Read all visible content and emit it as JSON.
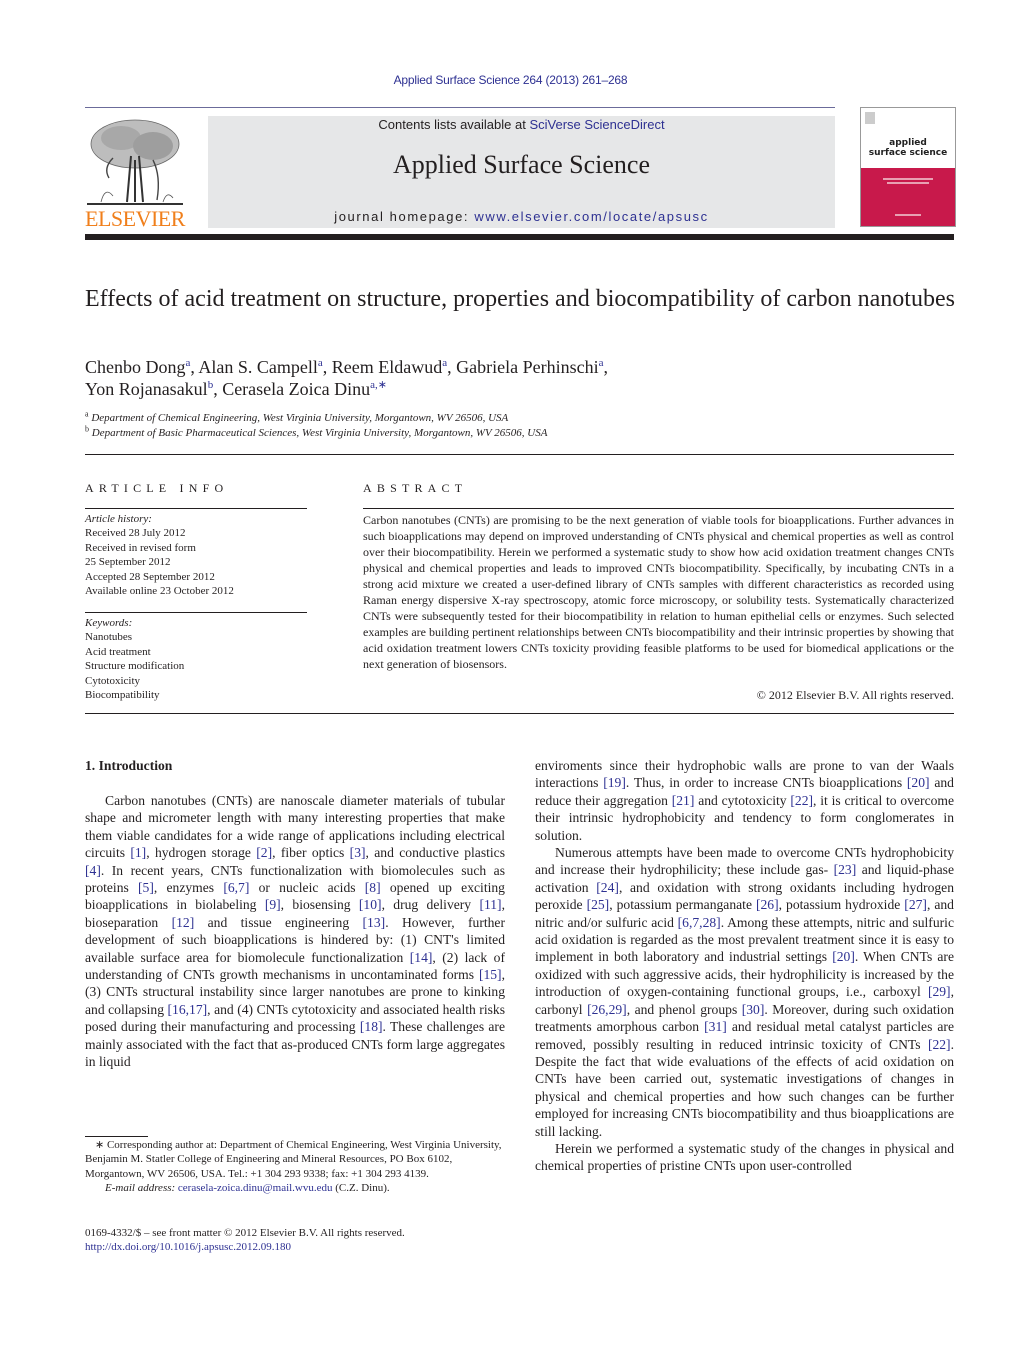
{
  "header": {
    "citation": "Applied Surface Science 264 (2013) 261–268",
    "contents_prefix": "Contents lists available at ",
    "contents_link": "SciVerse ScienceDirect",
    "journal_title": "Applied Surface Science",
    "homepage_prefix": "journal homepage: ",
    "homepage_link": "www.elsevier.com/locate/apsusc",
    "publisher_logo_text": "ELSEVIER",
    "cover_title_line1": "applied",
    "cover_title_line2": "surface science"
  },
  "article": {
    "title": "Effects of acid treatment on structure, properties and biocompatibility of carbon nanotubes",
    "authors": [
      {
        "name": "Chenbo Dong",
        "aff": "a",
        "sep": ", "
      },
      {
        "name": "Alan S. Campell",
        "aff": "a",
        "sep": ", "
      },
      {
        "name": "Reem Eldawud",
        "aff": "a",
        "sep": ", "
      },
      {
        "name": "Gabriela Perhinschi",
        "aff": "a",
        "sep": ","
      },
      {
        "name": "Yon Rojanasakul",
        "aff": "b",
        "sep": ", "
      },
      {
        "name": "Cerasela Zoica Dinu",
        "aff": "a,∗",
        "sep": ""
      }
    ],
    "affiliations": [
      {
        "mark": "a",
        "text": "Department of Chemical Engineering, West Virginia University, Morgantown, WV 26506, USA"
      },
      {
        "mark": "b",
        "text": "Department of Basic Pharmaceutical Sciences, West Virginia University, Morgantown, WV 26506, USA"
      }
    ]
  },
  "article_info": {
    "heading": "ARTICLE INFO",
    "history_label": "Article history:",
    "history": [
      "Received 28 July 2012",
      "Received in revised form",
      "25 September 2012",
      "Accepted 28 September 2012",
      "Available online 23 October 2012"
    ],
    "keywords_label": "Keywords:",
    "keywords": [
      "Nanotubes",
      "Acid treatment",
      "Structure modification",
      "Cytotoxicity",
      "Biocompatibility"
    ]
  },
  "abstract": {
    "heading": "ABSTRACT",
    "text": "Carbon nanotubes (CNTs) are promising to be the next generation of viable tools for bioapplications. Further advances in such bioapplications may depend on improved understanding of CNTs physical and chemical properties as well as control over their biocompatibility. Herein we performed a systematic study to show how acid oxidation treatment changes CNTs physical and chemical properties and leads to improved CNTs biocompatibility. Specifically, by incubating CNTs in a strong acid mixture we created a user-defined library of CNTs samples with different characteristics as recorded using Raman energy dispersive X-ray spectroscopy, atomic force microscopy, or solubility tests. Systematically characterized CNTs were subsequently tested for their biocompatibility in relation to human epithelial cells or enzymes. Such selected examples are building pertinent relationships between CNTs biocompatibility and their intrinsic properties by showing that acid oxidation treatment lowers CNTs toxicity providing feasible platforms to be used for biomedical applications or the next generation of biosensors.",
    "copyright": "© 2012 Elsevier B.V. All rights reserved."
  },
  "body": {
    "intro_heading": "1.  Introduction",
    "left_paragraphs": [
      [
        {
          "t": "Carbon nanotubes (CNTs) are nanoscale diameter materials of tubular shape and micrometer length with many interesting properties that make them viable candidates for a wide range of applications including electrical circuits "
        },
        {
          "r": "[1]"
        },
        {
          "t": ", hydrogen storage "
        },
        {
          "r": "[2]"
        },
        {
          "t": ", fiber optics "
        },
        {
          "r": "[3]"
        },
        {
          "t": ", and conductive plastics "
        },
        {
          "r": "[4]"
        },
        {
          "t": ". In recent years, CNTs functionalization with biomolecules such as proteins "
        },
        {
          "r": "[5]"
        },
        {
          "t": ", enzymes "
        },
        {
          "r": "[6,7]"
        },
        {
          "t": " or nucleic acids "
        },
        {
          "r": "[8]"
        },
        {
          "t": " opened up exciting bioapplications in biolabeling "
        },
        {
          "r": "[9]"
        },
        {
          "t": ", biosensing "
        },
        {
          "r": "[10]"
        },
        {
          "t": ", drug delivery "
        },
        {
          "r": "[11]"
        },
        {
          "t": ", bioseparation "
        },
        {
          "r": "[12]"
        },
        {
          "t": " and tissue engineering "
        },
        {
          "r": "[13]"
        },
        {
          "t": ". However, further development of such bioapplications is hindered by: (1) CNT's limited available surface area for biomolecule functionalization "
        },
        {
          "r": "[14]"
        },
        {
          "t": ", (2) lack of understanding of CNTs growth mechanisms in uncontaminated forms "
        },
        {
          "r": "[15]"
        },
        {
          "t": ", (3) CNTs structural instability since larger nanotubes are prone to kinking and collapsing "
        },
        {
          "r": "[16,17]"
        },
        {
          "t": ", and (4) CNTs cytotoxicity and associated health risks posed during their manufacturing and processing "
        },
        {
          "r": "[18]"
        },
        {
          "t": ". These challenges are mainly associated with the fact that as-produced CNTs form large aggregates in liquid"
        }
      ]
    ],
    "right_paragraphs": [
      {
        "indent": false,
        "runs": [
          {
            "t": "enviroments since their hydrophobic walls are prone to van der Waals interactions "
          },
          {
            "r": "[19]"
          },
          {
            "t": ". Thus, in order to increase CNTs bioapplications "
          },
          {
            "r": "[20]"
          },
          {
            "t": " and reduce their aggregation "
          },
          {
            "r": "[21]"
          },
          {
            "t": " and cytotoxicity "
          },
          {
            "r": "[22]"
          },
          {
            "t": ", it is critical to overcome their intrinsic hydrophobicity and tendency to form conglomerates in solution."
          }
        ]
      },
      {
        "indent": true,
        "runs": [
          {
            "t": "Numerous attempts have been made to overcome CNTs hydrophobicity and increase their hydrophilicity; these include gas- "
          },
          {
            "r": "[23]"
          },
          {
            "t": " and liquid-phase activation "
          },
          {
            "r": "[24]"
          },
          {
            "t": ", and oxidation with strong oxidants including hydrogen peroxide "
          },
          {
            "r": "[25]"
          },
          {
            "t": ", potassium permanganate "
          },
          {
            "r": "[26]"
          },
          {
            "t": ", potassium hydroxide "
          },
          {
            "r": "[27]"
          },
          {
            "t": ", and nitric and/or sulfuric acid "
          },
          {
            "r": "[6,7,28]"
          },
          {
            "t": ". Among these attempts, nitric and sulfuric acid oxidation is regarded as the most prevalent treatment since it is easy to implement in both laboratory and industrial settings "
          },
          {
            "r": "[20]"
          },
          {
            "t": ". When CNTs are oxidized with such aggressive acids, their hydrophilicity is increased by the introduction of oxygen-containing functional groups, i.e., carboxyl "
          },
          {
            "r": "[29]"
          },
          {
            "t": ", carbonyl "
          },
          {
            "r": "[26,29]"
          },
          {
            "t": ", and phenol groups "
          },
          {
            "r": "[30]"
          },
          {
            "t": ". Moreover, during such oxidation treatments amorphous carbon "
          },
          {
            "r": "[31]"
          },
          {
            "t": " and residual metal catalyst particles are removed, possibly resulting in reduced intrinsic toxicity of CNTs "
          },
          {
            "r": "[22]"
          },
          {
            "t": ". Despite the fact that wide evaluations of the effects of acid oxidation on CNTs have been carried out, systematic investigations of changes in physical and chemical properties and how such changes can be further employed for increasing CNTs biocompatibility and thus bioapplications are still lacking."
          }
        ]
      },
      {
        "indent": true,
        "runs": [
          {
            "t": "Herein we performed a systematic study of the changes in physical and chemical properties of pristine CNTs upon user-controlled"
          }
        ]
      }
    ]
  },
  "footnotes": {
    "corresponding": "∗ Corresponding author at: Department of Chemical Engineering, West Virginia University, Benjamin M. Statler College of Engineering and Mineral Resources, PO Box 6102, Morgantown, WV 26506, USA. Tel.: +1 304 293 9338; fax: +1 304 293 4139.",
    "email_label": "E-mail address: ",
    "email": "cerasela-zoica.dinu@mail.wvu.edu",
    "email_suffix": " (C.Z. Dinu).",
    "front_matter": "0169-4332/$ – see front matter © 2012 Elsevier B.V. All rights reserved.",
    "doi": "http://dx.doi.org/10.1016/j.apsusc.2012.09.180"
  },
  "colors": {
    "link": "#2e3192",
    "elsevier_orange": "#f07f1b",
    "cover_magenta": "#c8194b",
    "masthead_gray": "#e6e7e8"
  }
}
